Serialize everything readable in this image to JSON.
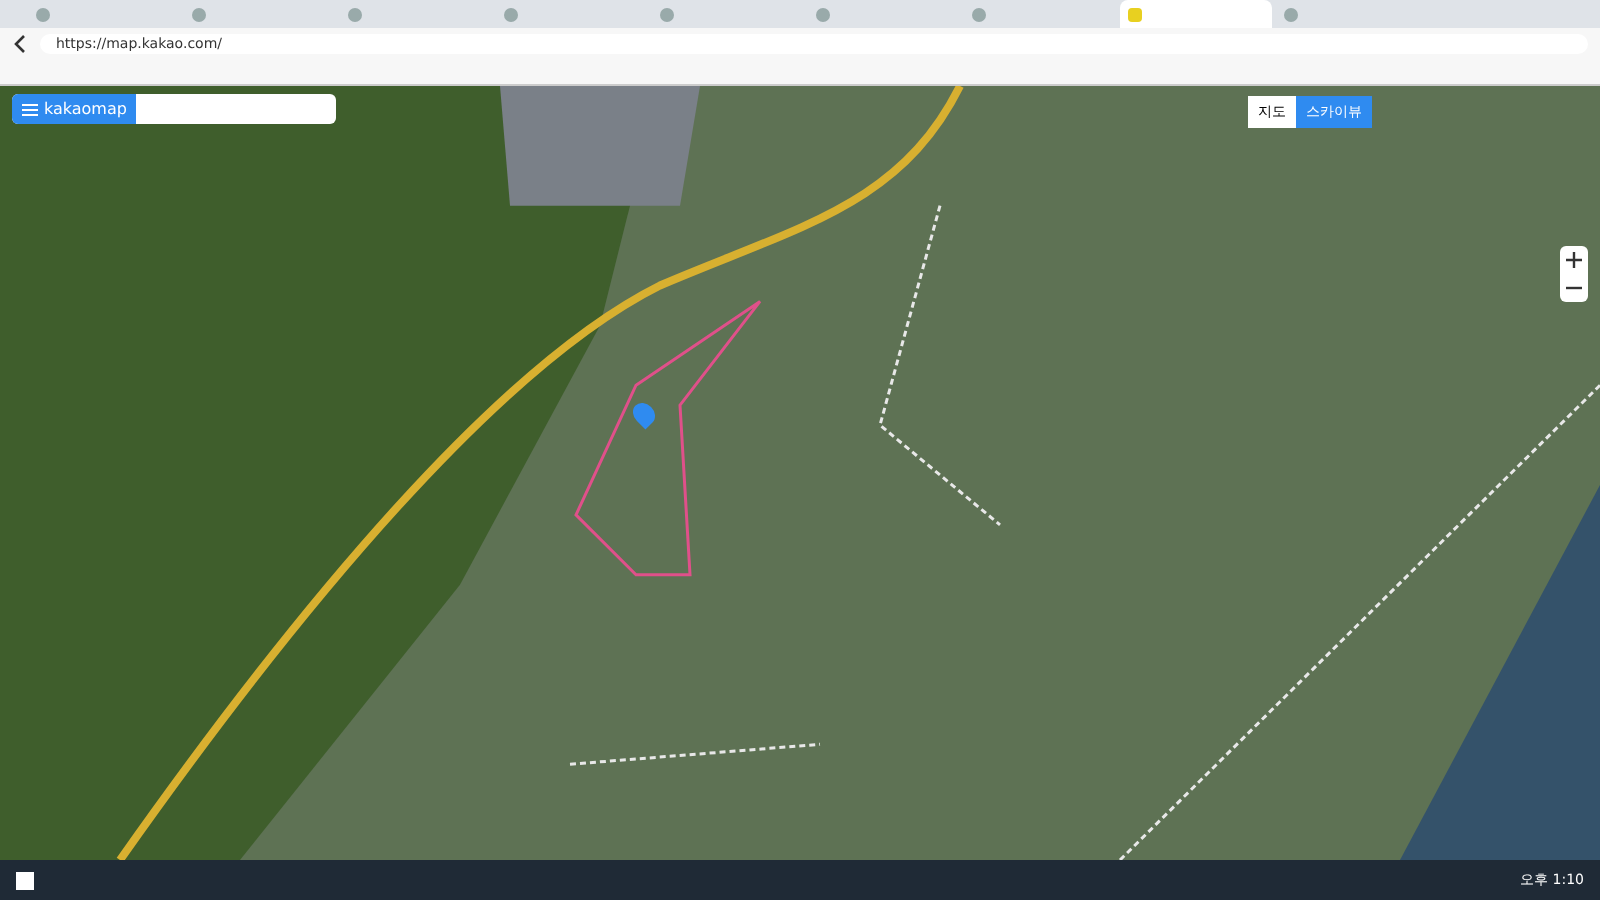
{
  "browser": {
    "tabs": [
      {
        "selected": false
      },
      {
        "selected": false
      },
      {
        "selected": false
      },
      {
        "selected": false
      },
      {
        "selected": false
      },
      {
        "selected": false
      },
      {
        "selected": false
      },
      {
        "selected": true
      },
      {
        "selected": false
      }
    ],
    "url": "https://map.kakao.com/"
  },
  "map": {
    "logo": "kakaomap",
    "view_buttons": [
      {
        "label": "지도",
        "selected": false
      },
      {
        "label": "스카이뷰",
        "selected": true
      }
    ]
  },
  "taskbar": {
    "time": "오후 1:10"
  }
}
